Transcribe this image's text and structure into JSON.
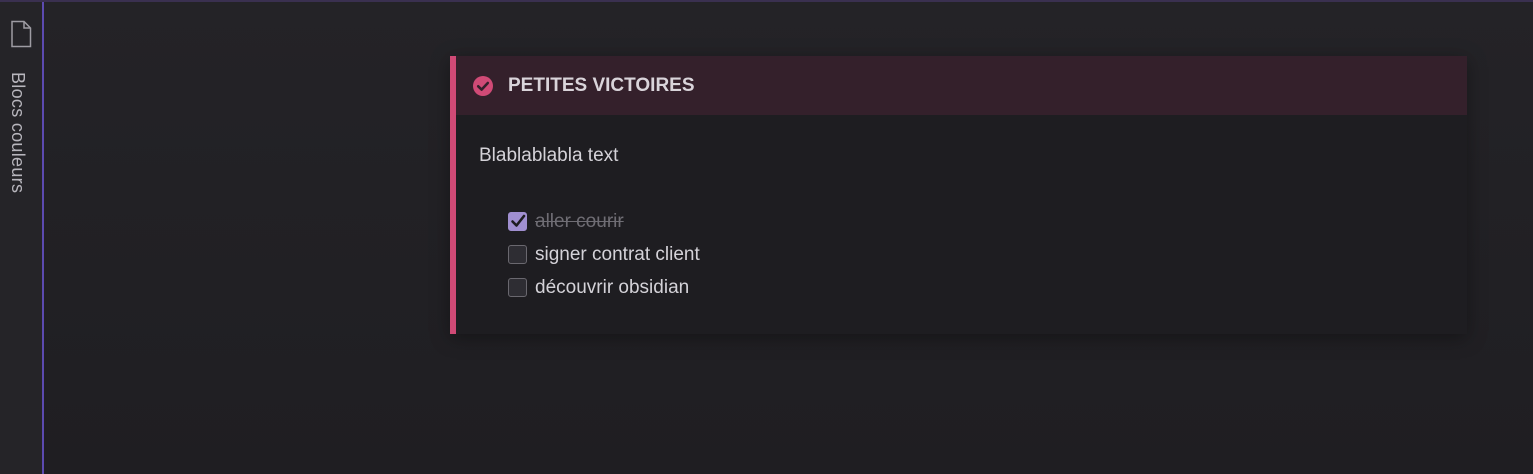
{
  "sidebar": {
    "icon": "file-icon",
    "tab_label": "Blocs couleurs"
  },
  "callout": {
    "icon": "check-circle-icon",
    "title": "PETITES VICTOIRES",
    "accent_color": "#d04a76",
    "body_text": "Blablablabla text",
    "tasks": [
      {
        "label": "aller courir",
        "checked": true
      },
      {
        "label": "signer contrat client",
        "checked": false
      },
      {
        "label": "découvrir obsidian",
        "checked": false
      }
    ]
  },
  "colors": {
    "sidebar_accent": "#5c4ab0",
    "checkbox_checked": "#a08fd0"
  }
}
